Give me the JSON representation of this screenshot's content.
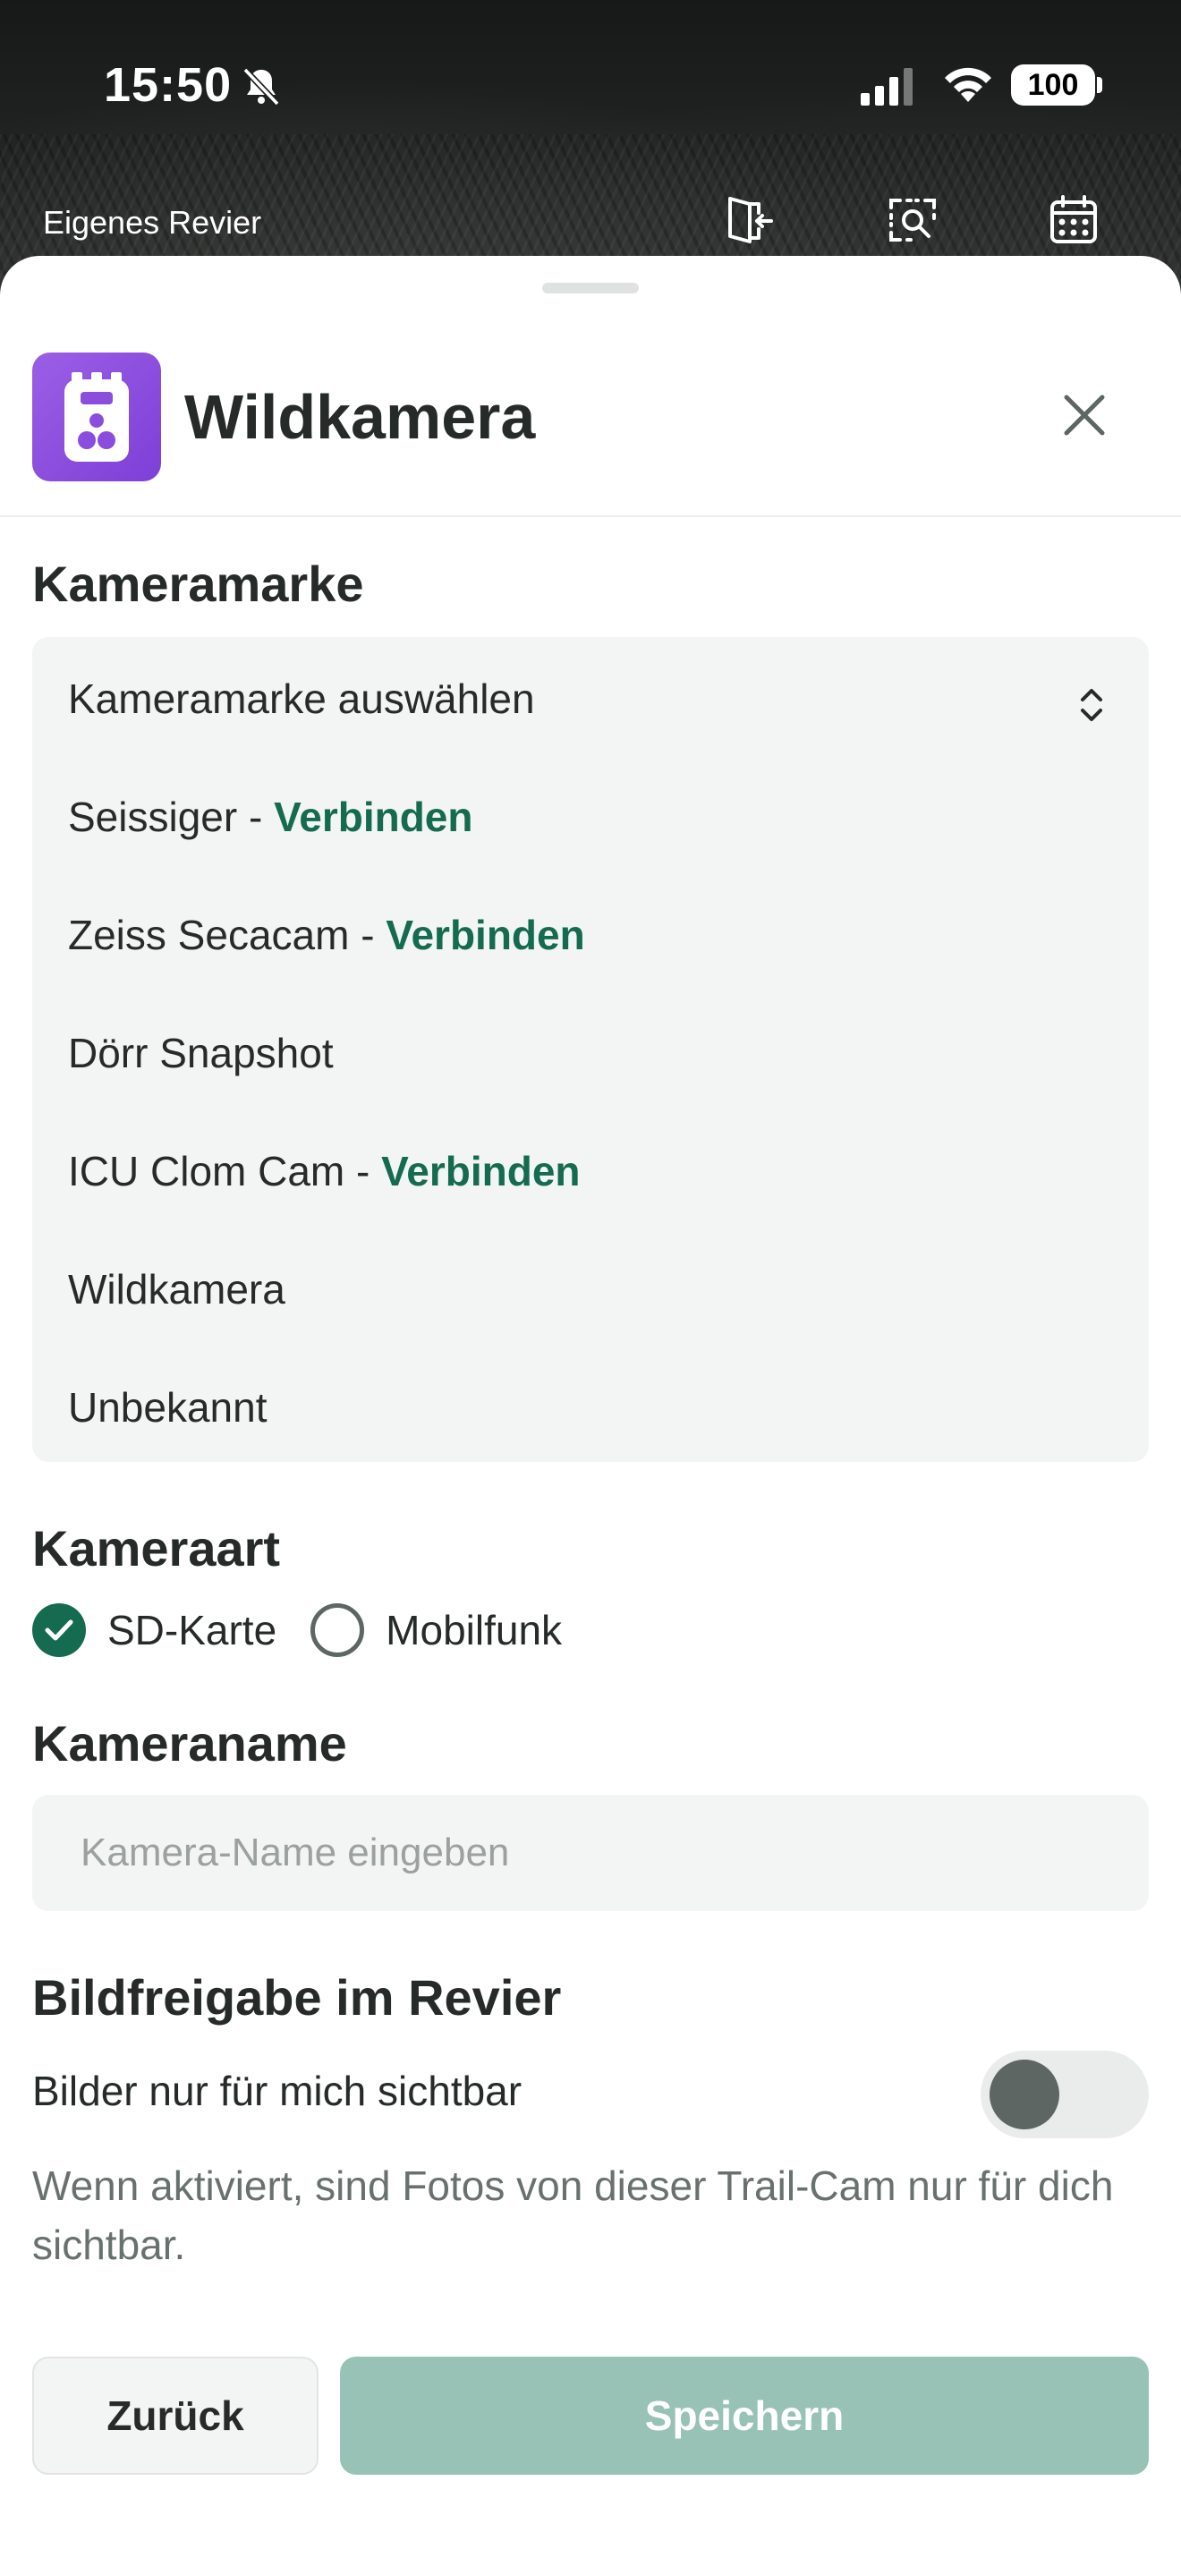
{
  "status_bar": {
    "time": "15:50",
    "battery": "100"
  },
  "header": {
    "revier_label": "Eigenes Revier"
  },
  "sheet": {
    "title": "Wildkamera"
  },
  "brand_section": {
    "title": "Kameramarke",
    "select_label": "Kameramarke auswählen",
    "items": [
      {
        "name": "Seissiger",
        "separator": " - ",
        "link": "Verbinden"
      },
      {
        "name": "Zeiss Secacam",
        "separator": " - ",
        "link": "Verbinden"
      },
      {
        "name": "Dörr Snapshot"
      },
      {
        "name": "ICU Clom Cam",
        "separator": " - ",
        "link": "Verbinden"
      },
      {
        "name": "Wildkamera"
      },
      {
        "name": "Unbekannt"
      }
    ]
  },
  "camera_type": {
    "title": "Kameraart",
    "options": [
      {
        "label": "SD-Karte",
        "selected": true
      },
      {
        "label": "Mobilfunk",
        "selected": false
      }
    ]
  },
  "camera_name": {
    "title": "Kameraname",
    "value": "",
    "placeholder": "Kamera-Name eingeben"
  },
  "image_sharing": {
    "title": "Bildfreigabe im Revier",
    "toggle_label": "Bilder nur für mich sichtbar",
    "toggle_on": false,
    "hint": "Wenn aktiviert, sind Fotos von dieser Trail-Cam nur für dich sichtbar."
  },
  "buttons": {
    "back": "Zurück",
    "save": "Speichern"
  },
  "colors": {
    "accent_green": "#146b4f",
    "save_disabled": "#98c2b6",
    "app_icon_purple": "#8a4ddd"
  }
}
